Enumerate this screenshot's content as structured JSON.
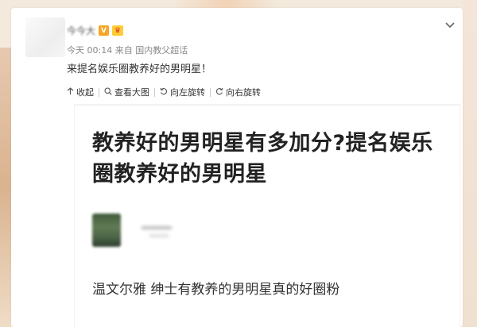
{
  "post": {
    "user_name": "今今大",
    "verified_badge": "V",
    "vip_badge": "♛",
    "time": "今天 00:14",
    "source_prefix": "来自",
    "source": "国内教父超话",
    "text": "来提名娱乐圈教养好的男明星！"
  },
  "toolbar": {
    "collapse_label": "收起",
    "view_large_label": "查看大图",
    "rotate_left_label": "向左旋转",
    "rotate_right_label": "向右旋转"
  },
  "image": {
    "title": "教养好的男明星有多加分?提名娱乐圈教养好的男明星",
    "subtitle": "温文尔雅 绅士有教养的男明星真的好圈粉"
  },
  "icons": {
    "menu": "chevron-down-icon",
    "collapse": "arrow-up-icon",
    "view_large": "magnifier-icon",
    "rotate_left": "rotate-left-icon",
    "rotate_right": "rotate-right-icon"
  },
  "colors": {
    "accent": "#f5a623",
    "text": "#333333",
    "muted": "#888888"
  }
}
